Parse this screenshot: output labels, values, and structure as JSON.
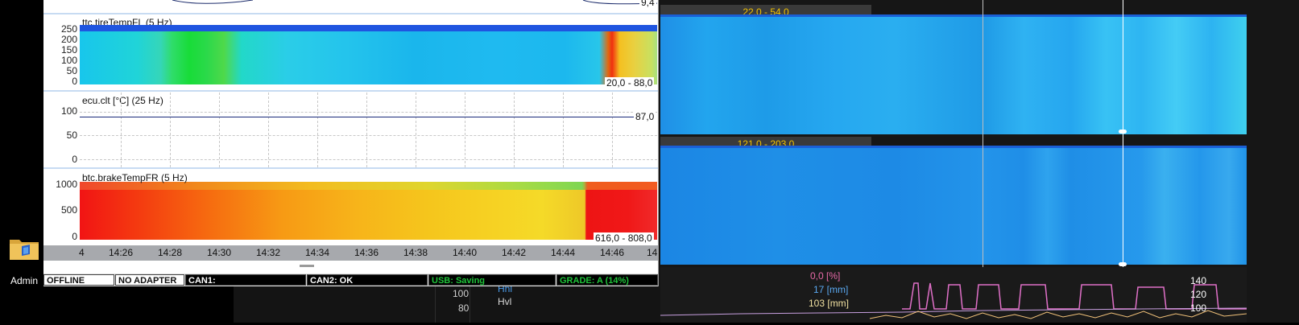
{
  "desktop": {
    "icon_label": "Admin",
    "folder_icon": "folder-icon"
  },
  "window": {
    "tire_panel": {
      "title": "ttc.tireTempFL (5 Hz)",
      "yticks": [
        "250",
        "200",
        "150",
        "100",
        "50",
        "0"
      ],
      "range": "20,0 - 88,0"
    },
    "clt_panel": {
      "title": "ecu.clt [°C] (25 Hz)",
      "yticks": [
        "100",
        "50",
        "0"
      ],
      "value": "87,0"
    },
    "brake_panel": {
      "title": "btc.brakeTempFR (5 Hz)",
      "yticks": [
        "1000",
        "500",
        "0"
      ],
      "range": "616,0 - 808,0"
    },
    "top_strip_value": "9,4",
    "time_axis": [
      "4",
      "14:26",
      "14:28",
      "14:30",
      "14:32",
      "14:34",
      "14:36",
      "14:38",
      "14:40",
      "14:42",
      "14:44",
      "14:46",
      "14"
    ],
    "status": {
      "offline": "OFFLINE",
      "adapter": "NO ADAPTER",
      "can1": "CAN1:",
      "can2": "CAN2: OK",
      "usb": "USB: Saving",
      "grade": "GRADE: A (14%)"
    },
    "colors": {
      "status_green": "#1fc43a",
      "time_axis_bg": "#a7a9ad",
      "tire_range_bar": "#1f55e0"
    }
  },
  "background_app": {
    "range_top": "22,0 - 54,0",
    "range_mid": "121,0 - 203,0",
    "readouts": [
      "0,0 [%]",
      "17 [mm]",
      "103 [mm]"
    ],
    "left_labels": [
      "100",
      "80"
    ],
    "legend": [
      "Hhl",
      "Hvl"
    ],
    "right_ticks": [
      "140",
      "120",
      "100"
    ]
  }
}
